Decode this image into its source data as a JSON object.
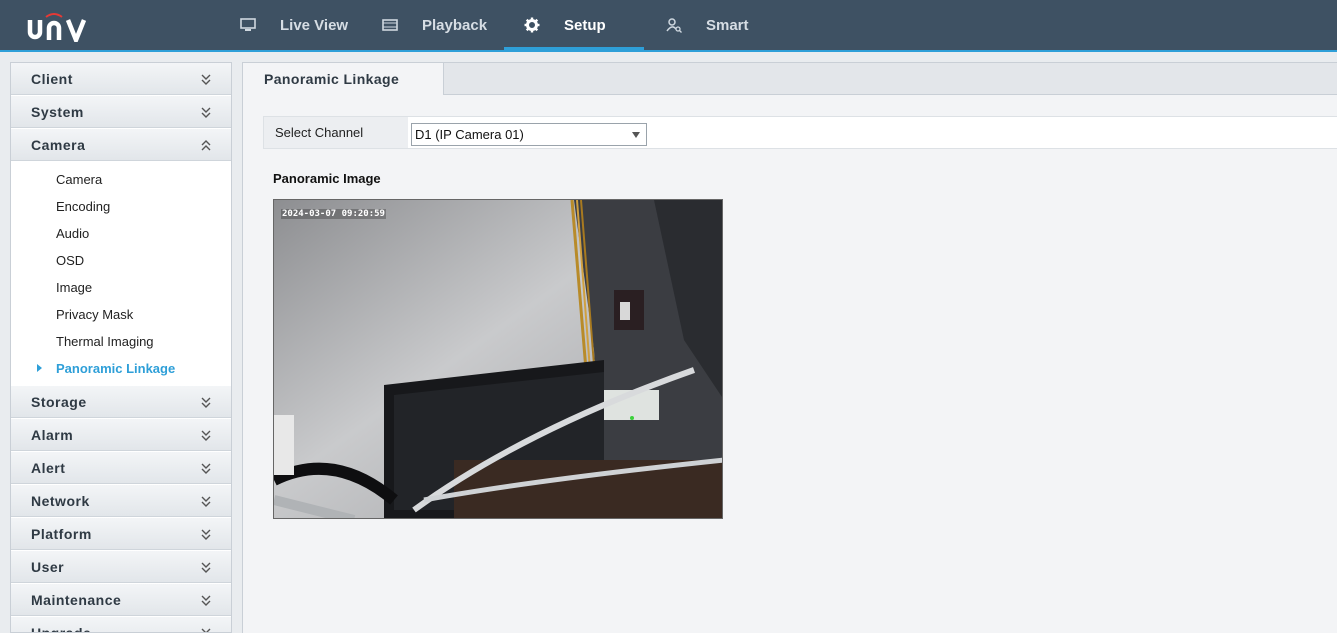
{
  "brand": {
    "logo_text": "unv"
  },
  "nav": [
    {
      "label": "Live View",
      "icon": "monitor-icon"
    },
    {
      "label": "Playback",
      "icon": "film-icon"
    },
    {
      "label": "Setup",
      "icon": "gear-icon",
      "active": true
    },
    {
      "label": "Smart",
      "icon": "person-search-icon"
    }
  ],
  "sidebar": {
    "sections": [
      {
        "label": "Client"
      },
      {
        "label": "System"
      },
      {
        "label": "Camera",
        "expanded": true
      },
      {
        "label": "Storage"
      },
      {
        "label": "Alarm"
      },
      {
        "label": "Alert"
      },
      {
        "label": "Network"
      },
      {
        "label": "Platform"
      },
      {
        "label": "User"
      },
      {
        "label": "Maintenance"
      },
      {
        "label": "Upgrade"
      }
    ],
    "camera_items": [
      "Camera",
      "Encoding",
      "Audio",
      "OSD",
      "Image",
      "Privacy Mask",
      "Thermal Imaging",
      "Panoramic Linkage"
    ],
    "active_item": "Panoramic Linkage"
  },
  "main": {
    "tab_label": "Panoramic Linkage",
    "select_channel_label": "Select Channel",
    "channel_value": "D1 (IP Camera 01)",
    "panoramic_image_label": "Panoramic Image",
    "timestamp": "2024-03-07 09:20:59"
  },
  "colors": {
    "topbar": "#3e5163",
    "accent": "#2e9fd8"
  }
}
